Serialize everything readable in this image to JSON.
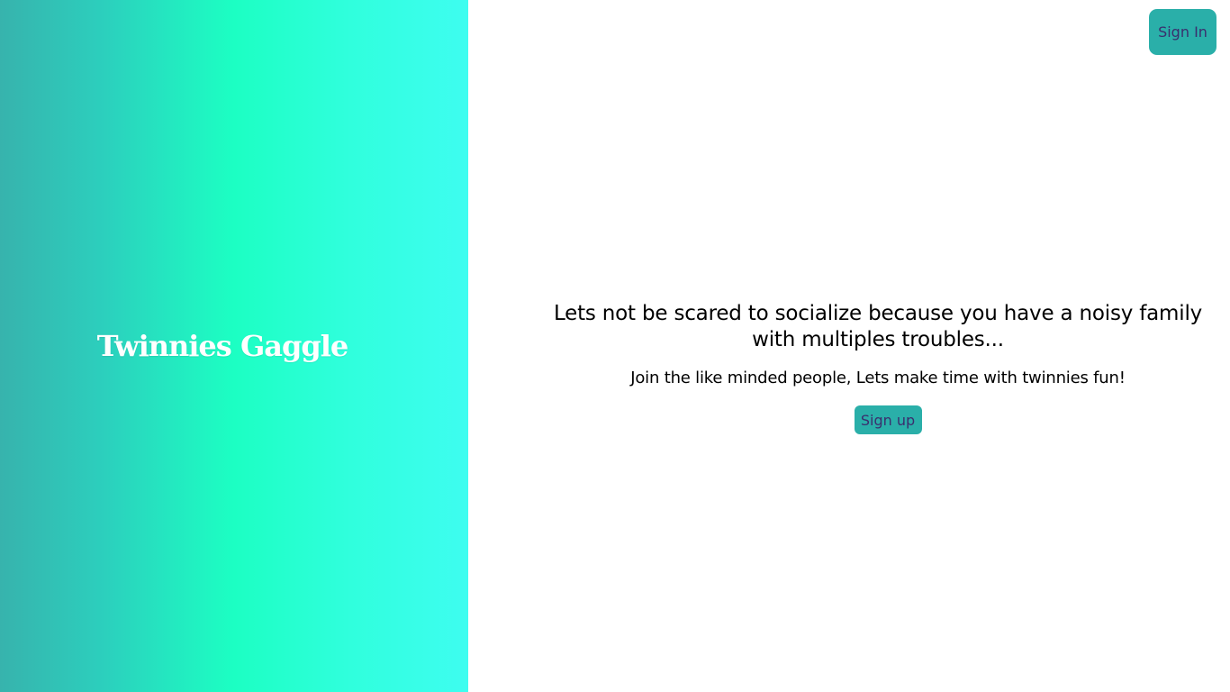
{
  "brand": {
    "title": "Twinnies Gaggle"
  },
  "header": {
    "sign_in_label": "Sign In"
  },
  "hero": {
    "headline": "Lets not be scared to socialize because you have a noisy family with multiples troubles...",
    "subtext": "Join the like minded people, Lets make time with twinnies fun!",
    "sign_up_label": "Sign up"
  },
  "colors": {
    "button_bg": "#2aafa9",
    "button_text": "#3a2f6e",
    "gradient_start": "#37b3ad",
    "gradient_mid": "#1cffc3",
    "gradient_end": "#3efdf0"
  }
}
